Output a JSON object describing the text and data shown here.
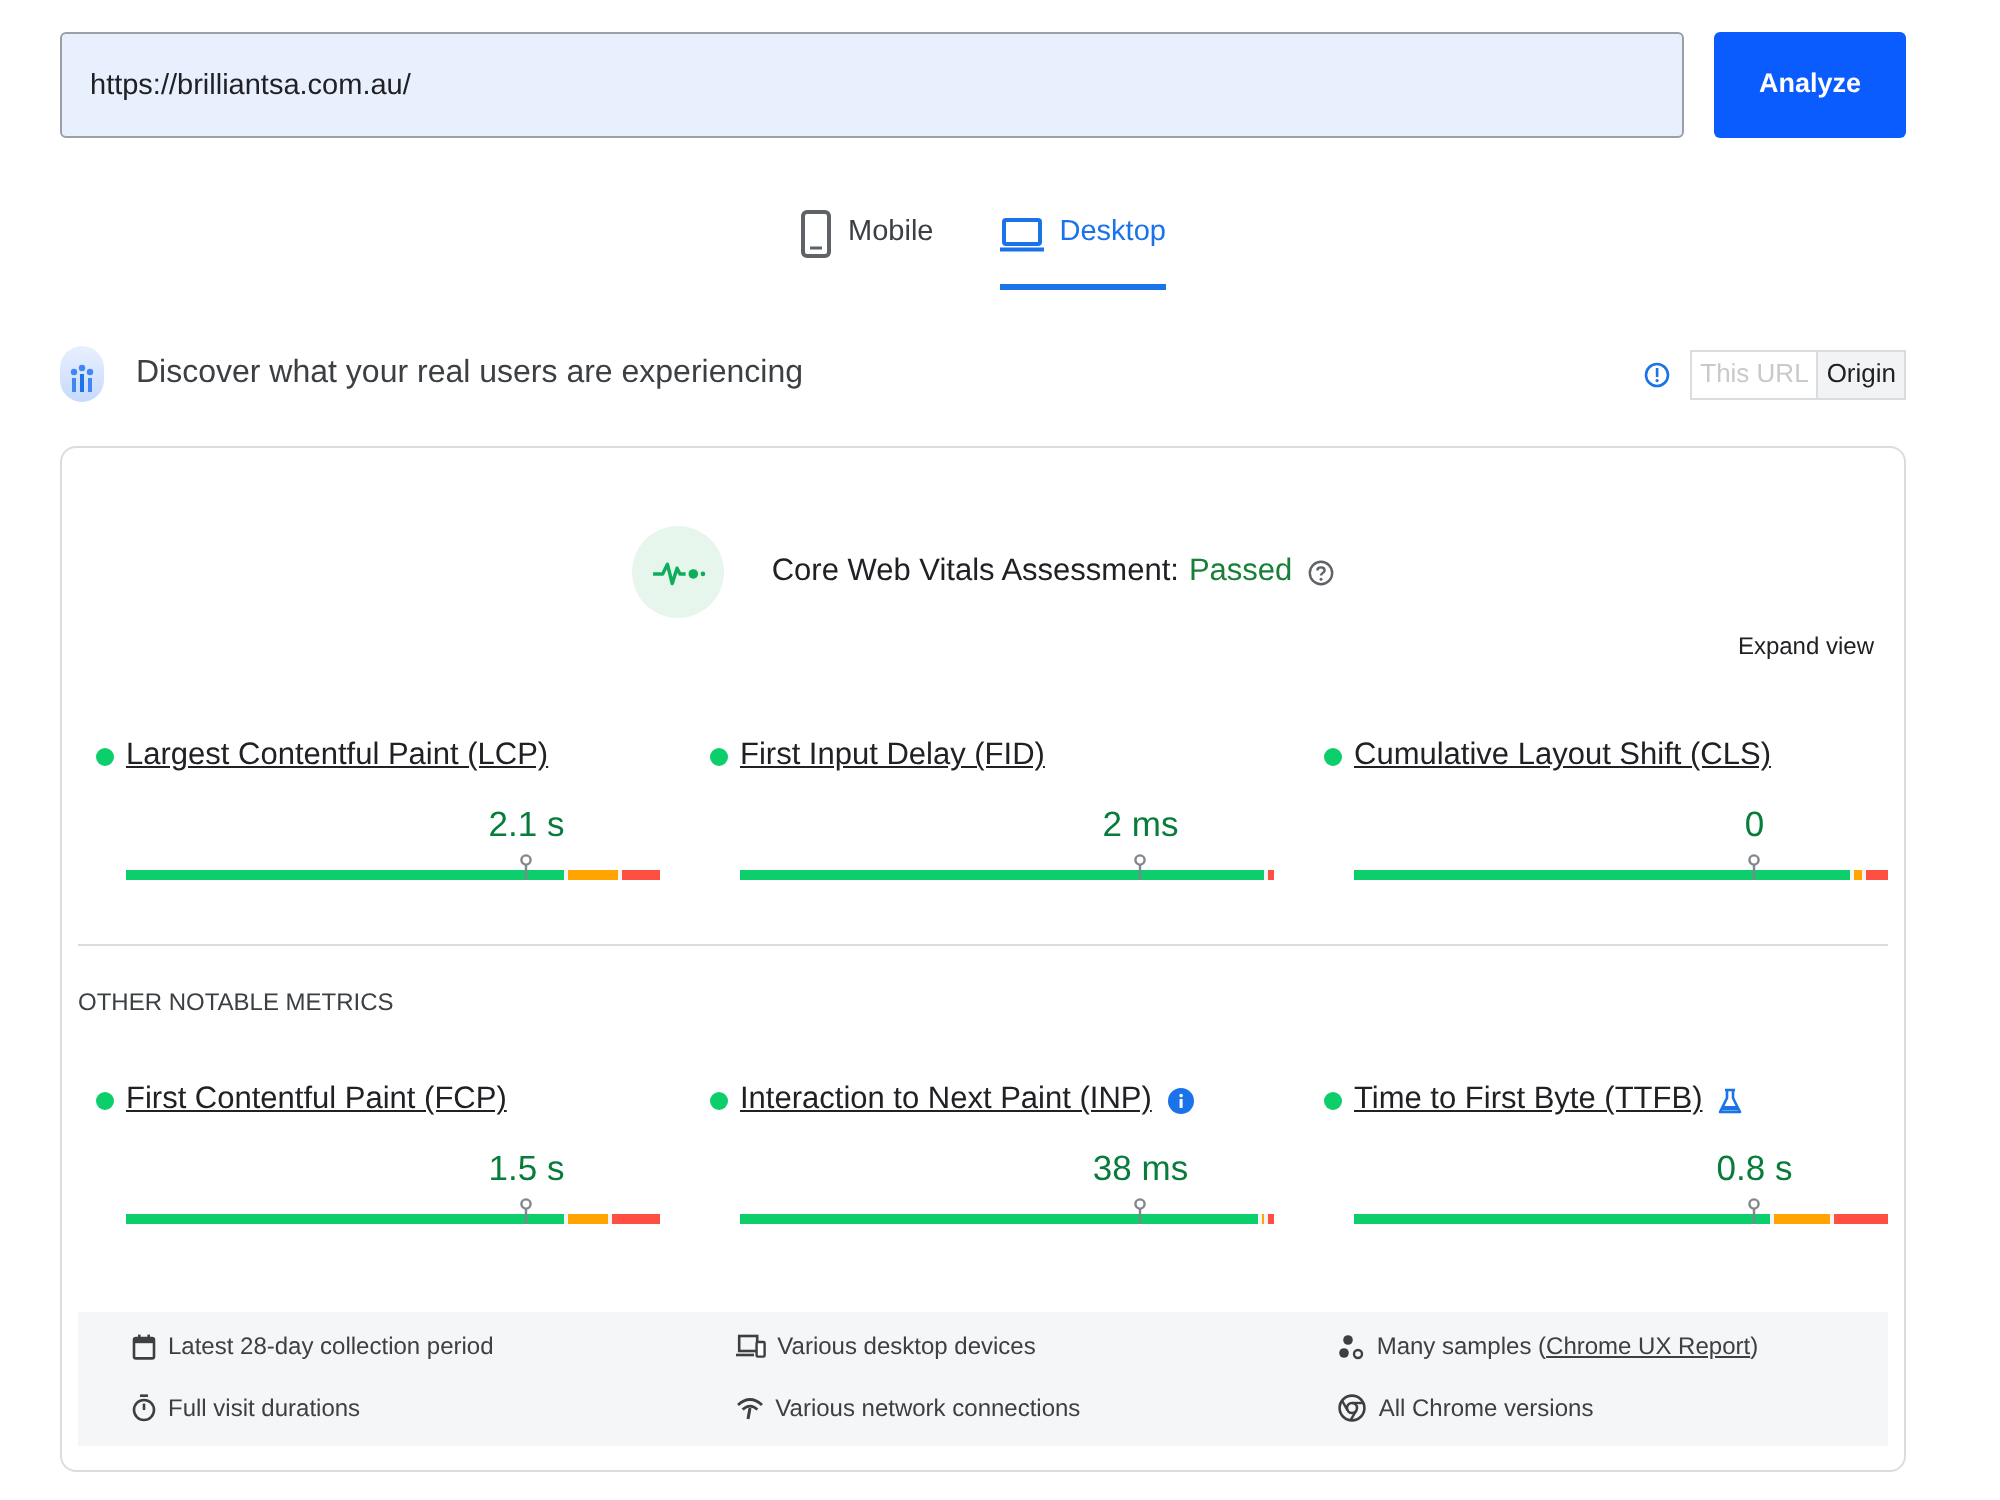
{
  "url_bar": {
    "value": "https://brilliantsa.com.au/",
    "button": "Analyze"
  },
  "tabs": [
    {
      "label": "Mobile",
      "selected": false
    },
    {
      "label": "Desktop",
      "selected": true
    }
  ],
  "field_data": {
    "heading": "Discover what your real users are experiencing",
    "scope": [
      {
        "label": "This URL",
        "selected": false,
        "disabled": true
      },
      {
        "label": "Origin",
        "selected": true,
        "disabled": false
      }
    ]
  },
  "assessment": {
    "label": "Core Web Vitals Assessment:",
    "result": "Passed",
    "passed": true,
    "expand": "Expand view"
  },
  "core_metrics": [
    {
      "name": "Largest Contentful Paint (LCP)",
      "value": "2.1 s",
      "color": "#0cce6b",
      "new": false,
      "experimental": false,
      "segments": [
        {
          "kind": "good",
          "level": 0.82
        },
        {
          "kind": "average"
        },
        {
          "kind": "poor",
          "level": 0.07
        }
      ]
    },
    {
      "name": "First Input Delay (FID)",
      "value": "2 ms",
      "color": "#0cce6b",
      "new": false,
      "experimental": false,
      "segments": [
        {
          "kind": "good",
          "level": 0.99
        },
        {
          "kind": "poor",
          "level": 0.01
        }
      ]
    },
    {
      "name": "Cumulative Layout Shift (CLS)",
      "value": "0",
      "color": "#0cce6b",
      "new": false,
      "experimental": false,
      "segments": [
        {
          "kind": "good",
          "level": 0.93
        },
        {
          "kind": "average"
        },
        {
          "kind": "poor",
          "level": 0.04
        }
      ]
    }
  ],
  "other_heading": "OTHER NOTABLE METRICS",
  "other_metrics": [
    {
      "name": "First Contentful Paint (FCP)",
      "value": "1.5 s",
      "color": "#0cce6b",
      "new": false,
      "experimental": false,
      "segments": [
        {
          "kind": "good",
          "level": 0.82
        },
        {
          "kind": "average"
        },
        {
          "kind": "poor",
          "level": 0.09
        }
      ]
    },
    {
      "name": "Interaction to Next Paint (INP)",
      "value": "38 ms",
      "color": "#0cce6b",
      "new": true,
      "experimental": false,
      "segments": [
        {
          "kind": "good",
          "level": 0.98
        },
        {
          "kind": "average"
        },
        {
          "kind": "poor",
          "level": 0.01
        }
      ]
    },
    {
      "name": "Time to First Byte (TTFB)",
      "value": "0.8 s",
      "color": "#0cce6b",
      "new": false,
      "experimental": true,
      "segments": [
        {
          "kind": "good",
          "level": 0.78
        },
        {
          "kind": "average"
        },
        {
          "kind": "poor",
          "level": 0.1
        }
      ]
    }
  ],
  "footer": [
    {
      "text": "Latest 28-day collection period"
    },
    {
      "text": "Various desktop devices"
    },
    {
      "text": "Many samples (",
      "link": "Chrome UX Report",
      "after": ")"
    },
    {
      "text": "Full visit durations"
    },
    {
      "text": "Various network connections"
    },
    {
      "text": "All Chrome versions"
    }
  ]
}
